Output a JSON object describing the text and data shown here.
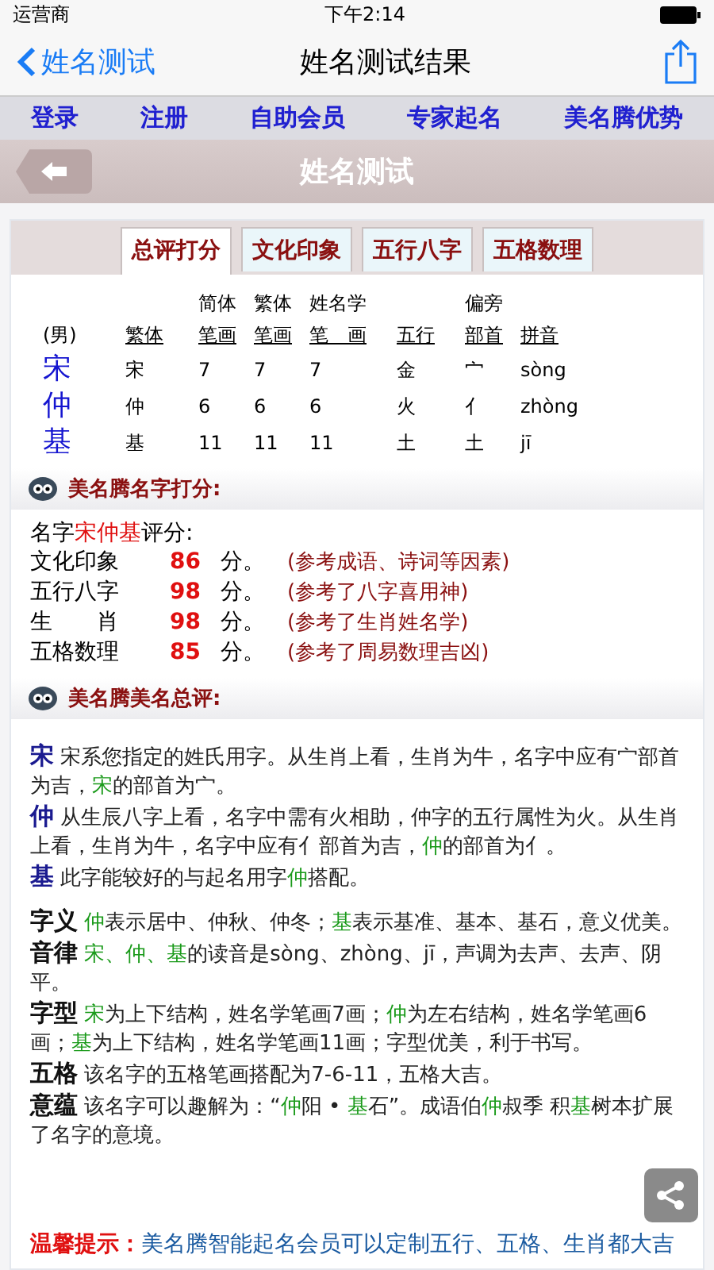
{
  "status_bar": {
    "carrier": "运营商",
    "time": "下午2:14"
  },
  "nav": {
    "back": "姓名测试",
    "title": "姓名测试结果"
  },
  "menu": [
    "登录",
    "注册",
    "自助会员",
    "专家起名",
    "美名腾优势"
  ],
  "page_title": "姓名测试",
  "tabs": [
    {
      "label": "总评打分",
      "selected": true
    },
    {
      "label": "文化印象",
      "selected": false
    },
    {
      "label": "五行八字",
      "selected": false
    },
    {
      "label": "五格数理",
      "selected": false
    }
  ],
  "table": {
    "columns": [
      {
        "header": "(男)"
      },
      {
        "header": "繁体"
      },
      {
        "top": "简体",
        "header": "笔画"
      },
      {
        "top": "繁体",
        "header": "笔画"
      },
      {
        "top": "姓名学",
        "header": "笔　画"
      },
      {
        "header": "五行"
      },
      {
        "top": "偏旁",
        "header": "部首"
      },
      {
        "header": "拼音"
      }
    ],
    "rows": [
      [
        "宋",
        "宋",
        "7",
        "7",
        "7",
        "金",
        "宀",
        "sòng"
      ],
      [
        "仲",
        "仲",
        "6",
        "6",
        "6",
        "火",
        "亻",
        "zhòng"
      ],
      [
        "基",
        "基",
        "11",
        "11",
        "11",
        "土",
        "土",
        "jī"
      ]
    ]
  },
  "score_section": {
    "title": "美名腾名字打分:",
    "intro": [
      {
        "text": "名字",
        "kind": "plain"
      },
      {
        "text": "宋仲基",
        "kind": "name"
      },
      {
        "text": "评分:",
        "kind": "plain"
      }
    ],
    "rows": [
      {
        "label": "文化印象",
        "score": "86",
        "unit": "分。",
        "note": "(参考成语、诗词等因素)"
      },
      {
        "label": "五行八字",
        "score": "98",
        "unit": "分。",
        "note": "(参考了八字喜用神)"
      },
      {
        "label": "生　　肖",
        "score": "98",
        "unit": "分。",
        "note": "(参考了生肖姓名学)"
      },
      {
        "label": "五格数理",
        "score": "85",
        "unit": "分。",
        "note": "(参考了周易数理吉凶)"
      }
    ]
  },
  "review_section": {
    "title": "美名腾美名总评:",
    "chars": [
      {
        "label": "宋",
        "segments": [
          {
            "text": "宋系您指定的姓氏用字。从生肖上看，生肖为牛，名字中应有宀部首为吉，",
            "kind": "plain"
          },
          {
            "text": "宋",
            "kind": "name"
          },
          {
            "text": "的部首为宀。",
            "kind": "plain"
          }
        ]
      },
      {
        "label": "仲",
        "segments": [
          {
            "text": "从生辰八字上看，名字中需有火相助，仲字的五行属性为火。从生肖上看，生肖为牛，名字中应有亻部首为吉，",
            "kind": "plain"
          },
          {
            "text": "仲",
            "kind": "name"
          },
          {
            "text": "的部首为亻。",
            "kind": "plain"
          }
        ]
      },
      {
        "label": "基",
        "segments": [
          {
            "text": "此字能较好的与起名用字",
            "kind": "plain"
          },
          {
            "text": "仲",
            "kind": "name"
          },
          {
            "text": "搭配。",
            "kind": "plain"
          }
        ]
      }
    ],
    "aspects": [
      {
        "label": "字义",
        "segments": [
          {
            "text": "仲",
            "kind": "name"
          },
          {
            "text": "表示居中、仲秋、仲冬；",
            "kind": "plain"
          },
          {
            "text": "基",
            "kind": "name"
          },
          {
            "text": "表示基准、基本、基石，意义优美。",
            "kind": "plain"
          }
        ]
      },
      {
        "label": "音律",
        "segments": [
          {
            "text": "宋、仲、基",
            "kind": "name"
          },
          {
            "text": "的读音是sòng、zhòng、jī，声调为去声、去声、阴平。",
            "kind": "plain"
          }
        ]
      },
      {
        "label": "字型",
        "segments": [
          {
            "text": "宋",
            "kind": "name"
          },
          {
            "text": "为上下结构，姓名学笔画7画；",
            "kind": "plain"
          },
          {
            "text": "仲",
            "kind": "name"
          },
          {
            "text": "为左右结构，姓名学笔画6画；",
            "kind": "plain"
          },
          {
            "text": "基",
            "kind": "name"
          },
          {
            "text": "为上下结构，姓名学笔画11画；字型优美，利于书写。",
            "kind": "plain"
          }
        ]
      },
      {
        "label": "五格",
        "segments": [
          {
            "text": "该名字的五格笔画搭配为7-6-11，五格大吉。",
            "kind": "plain"
          }
        ]
      },
      {
        "label": "意蕴",
        "segments": [
          {
            "text": "该名字可以趣解为：“",
            "kind": "plain"
          },
          {
            "text": "仲",
            "kind": "name"
          },
          {
            "text": "阳 • ",
            "kind": "plain"
          },
          {
            "text": "基",
            "kind": "name"
          },
          {
            "text": "石”。成语伯",
            "kind": "plain"
          },
          {
            "text": "仲",
            "kind": "name"
          },
          {
            "text": "叔季 积",
            "kind": "plain"
          },
          {
            "text": "基",
            "kind": "name"
          },
          {
            "text": "树本扩展了名字的意境。",
            "kind": "plain"
          }
        ]
      }
    ]
  },
  "tip": {
    "label": "温馨提示：",
    "text": "美名腾智能起名会员可以定制五行、五格、生肖都大吉"
  }
}
